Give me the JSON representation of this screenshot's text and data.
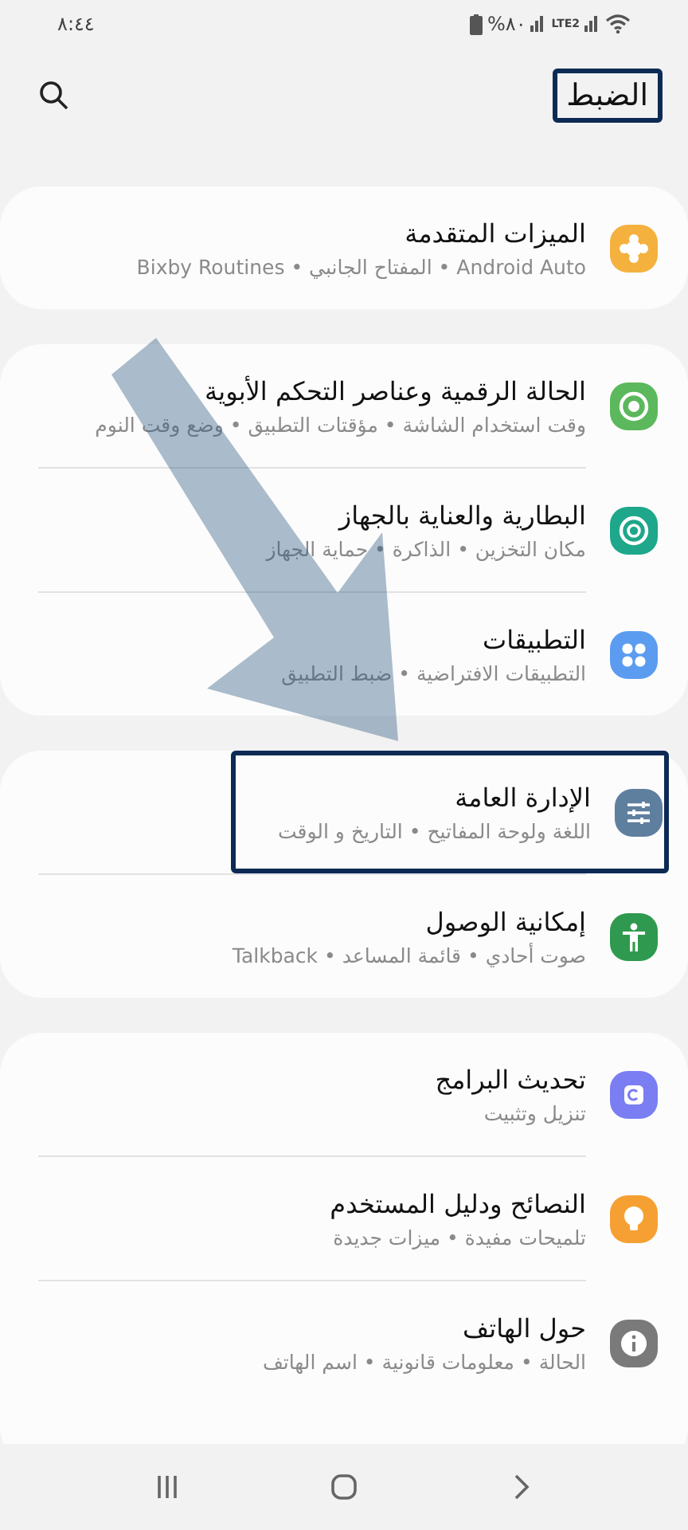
{
  "status_bar": {
    "battery": "%٨٠",
    "network": "LTE2",
    "time": "٨:٤٤"
  },
  "header": {
    "title": "الضبط",
    "highlighted": true
  },
  "groups": [
    {
      "items": [
        {
          "title": "الميزات المتقدمة",
          "subtitle": "Android Auto  •  المفتاح الجانبي  •  Bixby Routines",
          "color": "#f4b13e",
          "highlighted": false
        }
      ]
    },
    {
      "items": [
        {
          "title": "الحالة الرقمية وعناصر التحكم الأبوية",
          "subtitle": "وقت استخدام الشاشة  •  مؤقتات التطبيق  •  وضع وقت النوم",
          "color": "#5cb85c",
          "highlighted": false
        },
        {
          "title": "البطارية والعناية بالجهاز",
          "subtitle": "مكان التخزين  •  الذاكرة  •  حماية الجهاز",
          "color": "#1ea78a",
          "highlighted": false
        },
        {
          "title": "التطبيقات",
          "subtitle": "التطبيقات الافتراضية  •  ضبط التطبيق",
          "color": "#5b9cf0",
          "highlighted": false
        }
      ]
    },
    {
      "items": [
        {
          "title": "الإدارة العامة",
          "subtitle": "اللغة ولوحة المفاتيح  •  التاريخ و الوقت",
          "color": "#5f7f9f",
          "highlighted": true
        },
        {
          "title": "إمكانية الوصول",
          "subtitle": "صوت أحادي  •  قائمة المساعد  •  Talkback",
          "color": "#2f9a4f",
          "highlighted": false
        }
      ]
    },
    {
      "items": [
        {
          "title": "تحديث البرامج",
          "subtitle": "تنزيل وتثبيت",
          "color": "#7a7ef2",
          "highlighted": false
        },
        {
          "title": "النصائح ودليل المستخدم",
          "subtitle": "تلميحات مفيدة  •  ميزات جديدة",
          "color": "#f6a033",
          "highlighted": false
        },
        {
          "title": "حول الهاتف",
          "subtitle": "الحالة  •  معلومات قانونية  •  اسم الهاتف",
          "color": "#7a7a7a",
          "highlighted": false
        }
      ]
    }
  ]
}
